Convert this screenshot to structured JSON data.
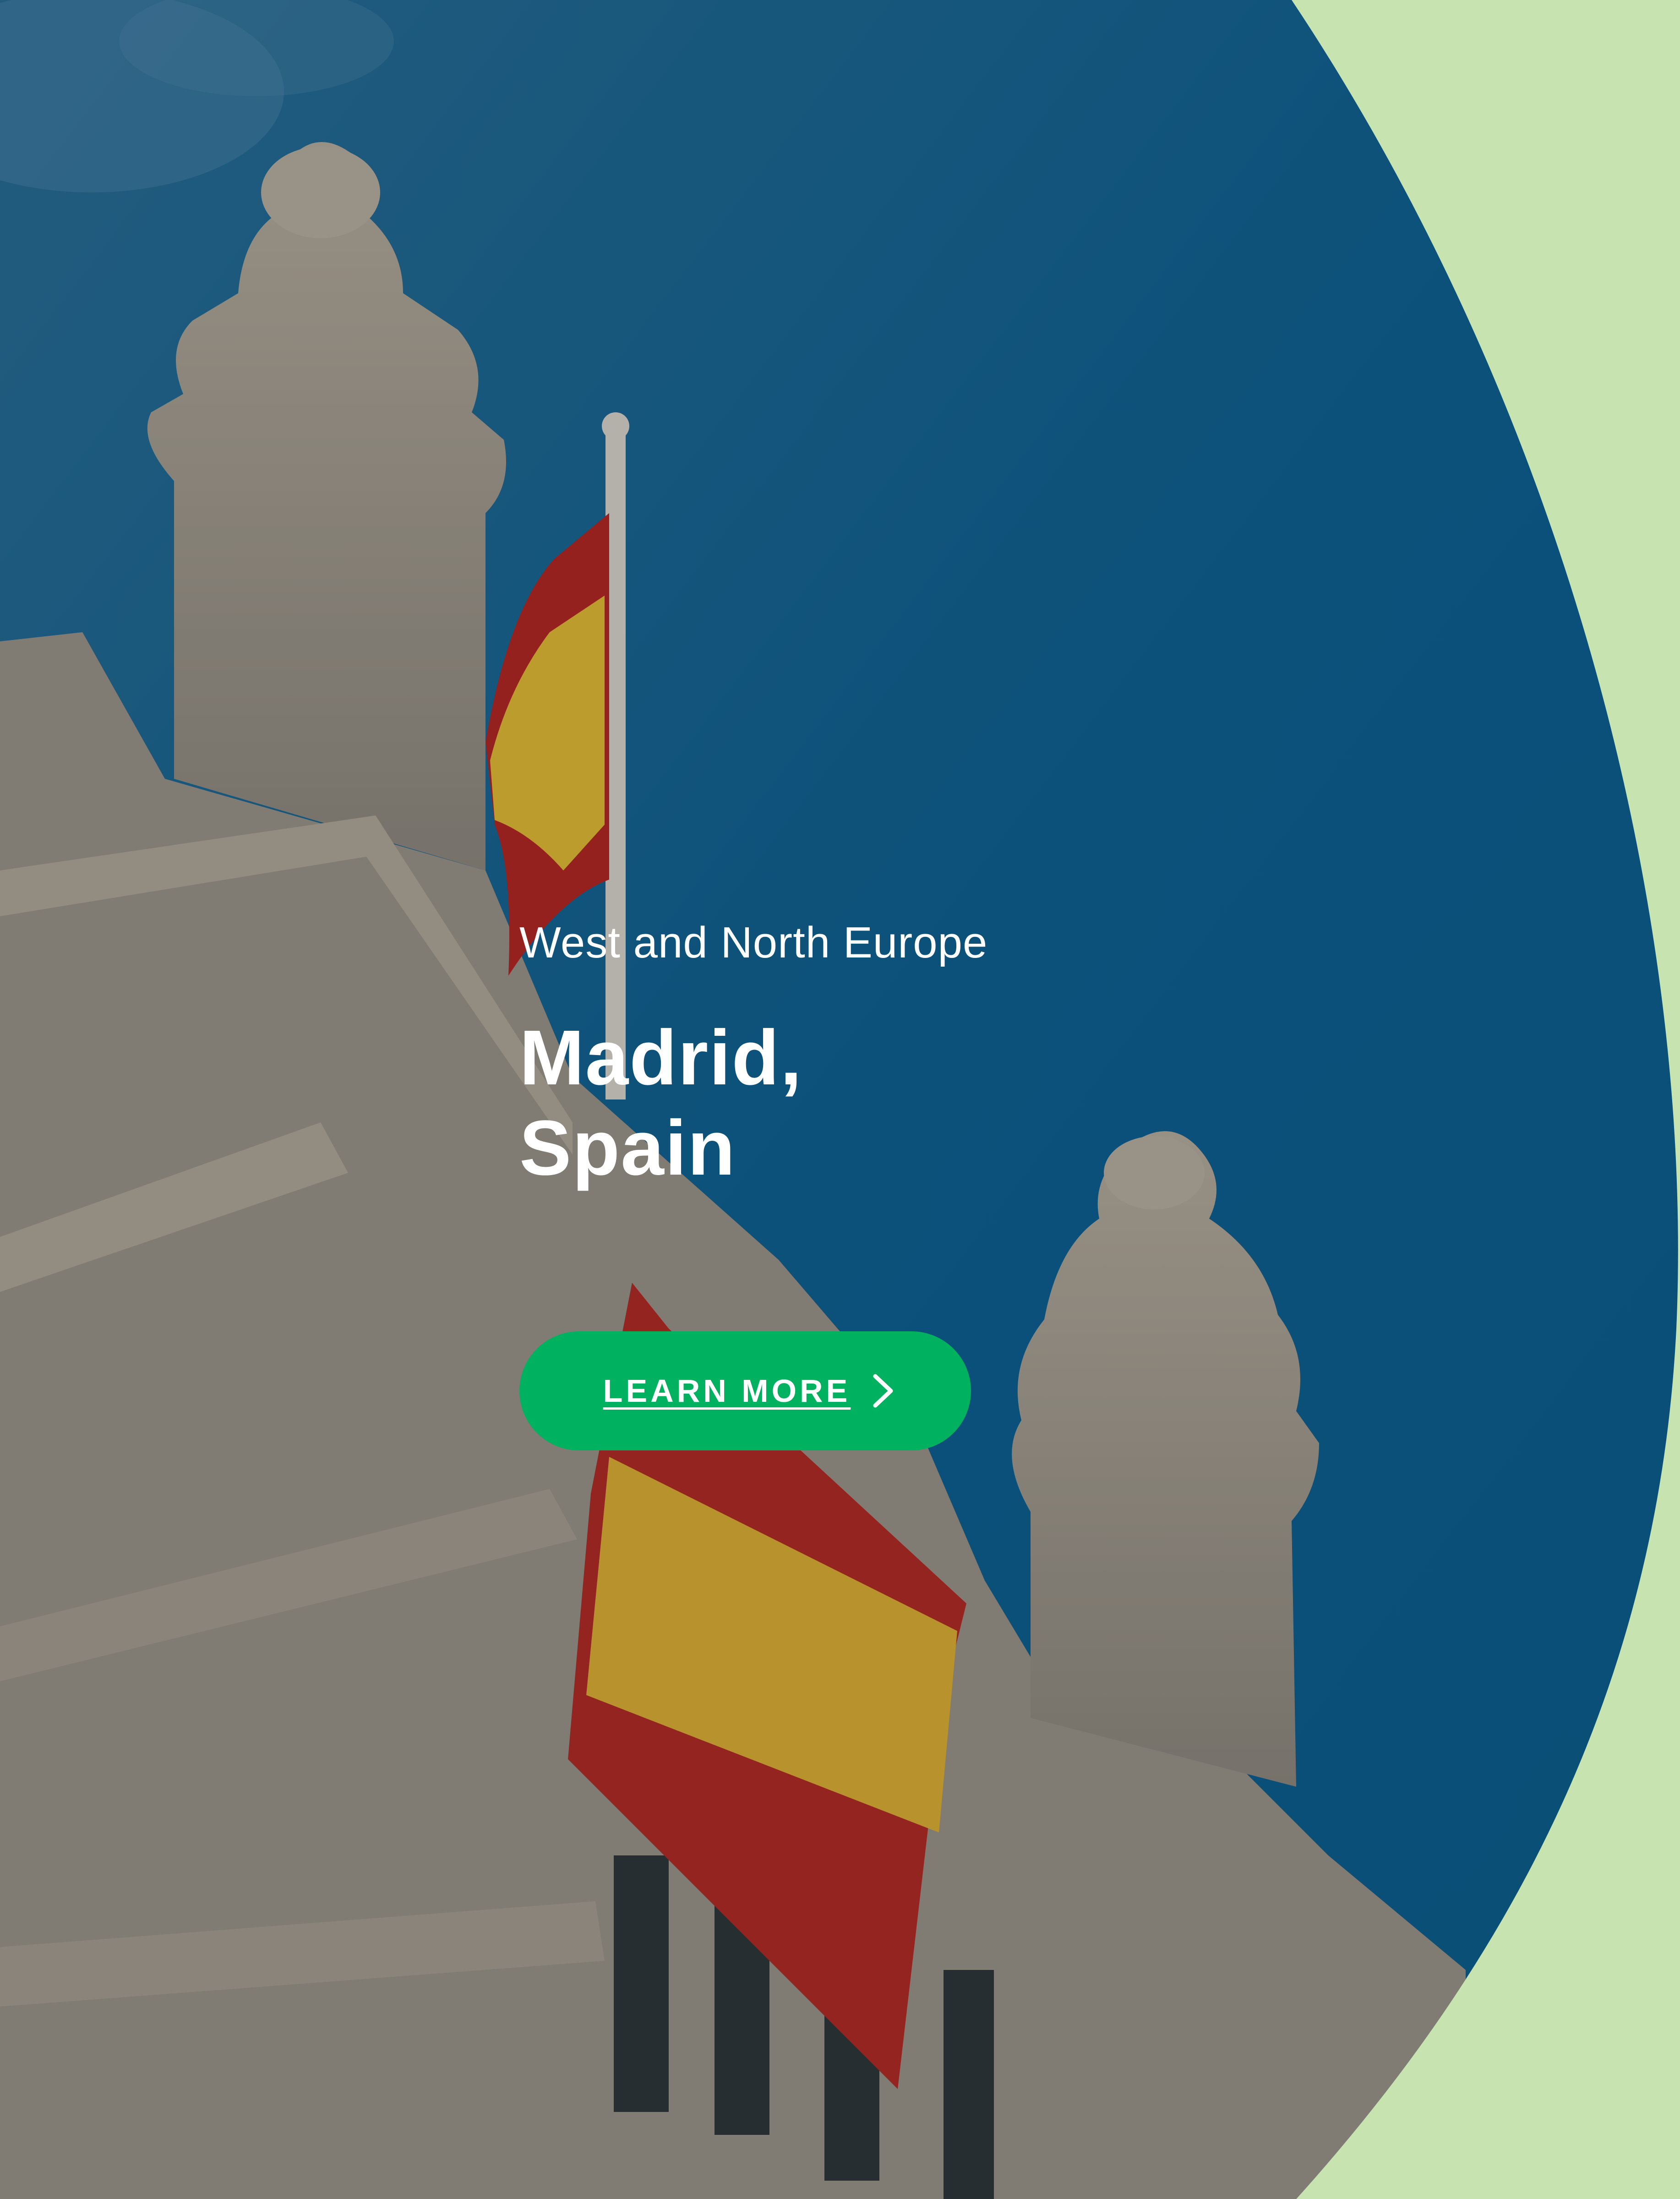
{
  "colors": {
    "accent_green": "#00b25f",
    "mint_background": "#c7e3b0",
    "sky_blue": "#0f5f8e",
    "text": "#ffffff"
  },
  "hero": {
    "image_subject": "ornate-building-with-spanish-flags",
    "region": "West and North Europe",
    "city_line1": "Madrid,",
    "city_line2": "Spain"
  },
  "cta": {
    "label": "LEARN MORE",
    "icon": "chevron-right-icon"
  }
}
